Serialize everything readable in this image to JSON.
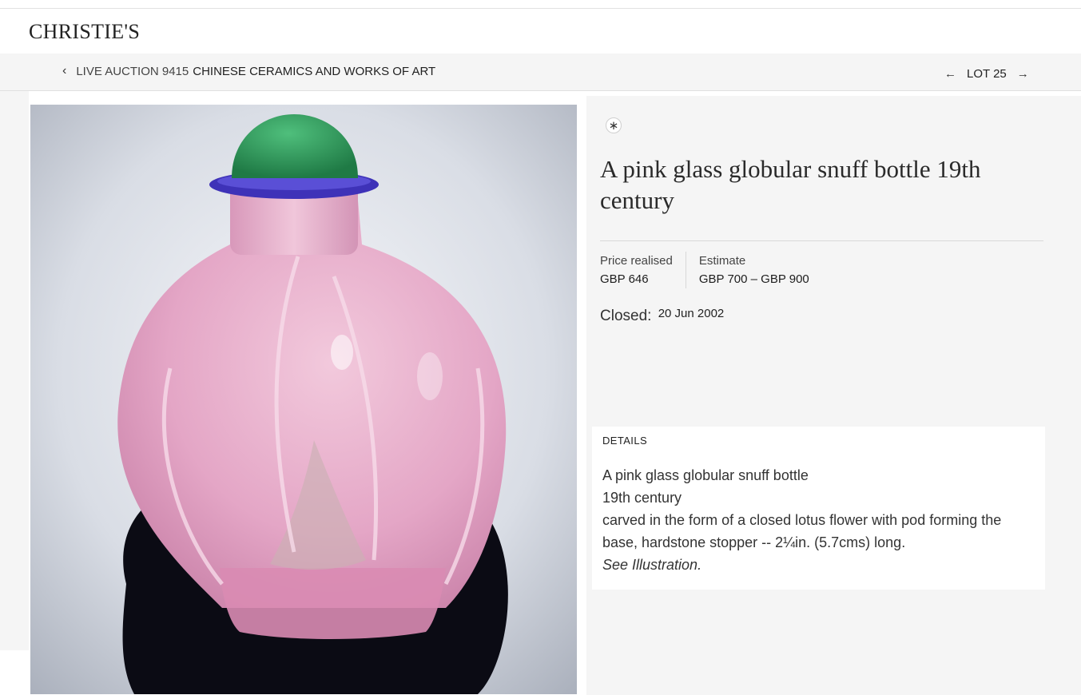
{
  "brand": {
    "logo_text": "CHRISTIE'S"
  },
  "breadcrumb": {
    "prefix": "LIVE AUCTION 9415",
    "sale_name": "CHINESE CERAMICS AND WORKS OF ART"
  },
  "lot_nav": {
    "label": "LOT 25"
  },
  "icons": {
    "back": "chevron-left-icon",
    "prev": "arrow-left-icon",
    "next": "arrow-right-icon",
    "favorite": "asterisk-icon"
  },
  "lot": {
    "title": "A pink glass globular snuff bottle 19th century",
    "price_realised_label": "Price realised",
    "price_realised_value": "GBP 646",
    "estimate_label": "Estimate",
    "estimate_value": "GBP 700 – GBP 900",
    "closed_label": "Closed:",
    "closed_date": "20 Jun 2002"
  },
  "details": {
    "heading": "DETAILS",
    "lines": [
      "A pink glass globular snuff bottle",
      "19th century",
      "carved in the form of a closed lotus flower with pod forming the",
      "base, hardstone stopper -- 2¼in. (5.7cms) long.",
      "See Illustration."
    ]
  },
  "colors": {
    "nav_background": "#f5f5f5",
    "bottle_pink": "#e4a6c6",
    "stopper_green": "#2e9e5c",
    "collar_blue": "#3e32b8"
  }
}
